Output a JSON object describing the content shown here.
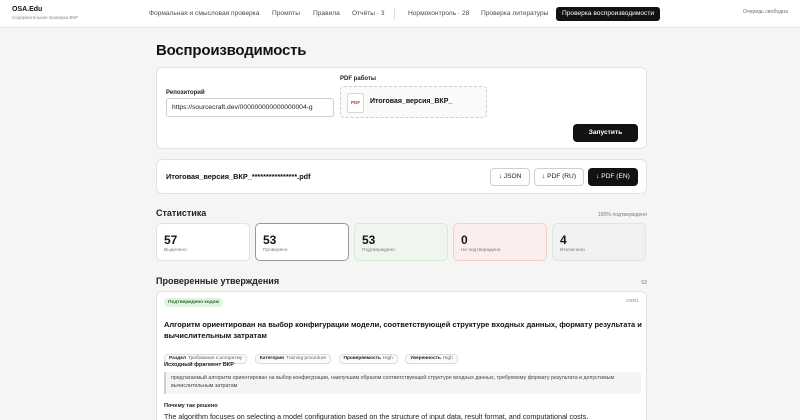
{
  "brand": {
    "title": "OSA.Edu",
    "subtitle": "Содержательная проверка ВКР"
  },
  "nav": [
    {
      "label": "Формальная и смысловая проверка",
      "active": false
    },
    {
      "label": "Промпты",
      "active": false
    },
    {
      "label": "Правила",
      "active": false
    },
    {
      "label": "Отчёты · 3",
      "active": false
    },
    {
      "label": "Нормоконтроль · 28",
      "active": false
    },
    {
      "label": "Проверка литературы",
      "active": false
    },
    {
      "label": "Проверка воспроизводимости",
      "active": true
    }
  ],
  "queue_status": "Очередь свободна",
  "page_title": "Воспроизводимость",
  "form": {
    "repo_label": "Репозиторий",
    "repo_value": "https://sourcecraft.dev/000000000000000004-g",
    "pdf_label": "PDF работы",
    "pdf_icon_text": "PDF",
    "pdf_file": "Итоговая_версия_ВКР_",
    "run_button": "Запустить"
  },
  "result": {
    "file_name": "Итоговая_версия_ВКР_****************.pdf",
    "buttons": {
      "json": "↓ JSON",
      "pdf_ru": "↓ PDF (RU)",
      "pdf_en": "↓ PDF (EN)"
    }
  },
  "stats": {
    "title": "Статистика",
    "note": "100% подтверждено",
    "items": [
      {
        "value": "57",
        "label": "Выделено"
      },
      {
        "value": "53",
        "label": "Проверено"
      },
      {
        "value": "53",
        "label": "Подтверждено"
      },
      {
        "value": "0",
        "label": "Не подтверждено"
      },
      {
        "value": "4",
        "label": "Исключено"
      }
    ]
  },
  "claims": {
    "title": "Проверенные утверждения",
    "count": "53",
    "item": {
      "badge": "Подтверждено кодом",
      "id": "c0001",
      "title": "Алгоритм ориентирован на выбор конфигурации модели, соответствующей структуре входных данных, формату результата и вычислительным затратам",
      "chips": [
        {
          "key": "Раздел",
          "value": "Требования к алгоритму"
        },
        {
          "key": "Категория",
          "value": "Training procedure"
        },
        {
          "key": "Проверяемость",
          "value": "High"
        },
        {
          "key": "Уверенность",
          "value": "High"
        }
      ],
      "source_label": "Исходный фрагмент ВКР",
      "source_text": "предлагаемый алгоритм ориентирован на выбор конфигурации, наилучшим образом соответствующей структуре входных данных, требуемому формату результата и допустимым вычислительным затратам",
      "why_label": "Почему так решено",
      "why_text": "The algorithm focuses on selecting a model configuration based on the structure of input data, result format, and computational costs."
    }
  }
}
